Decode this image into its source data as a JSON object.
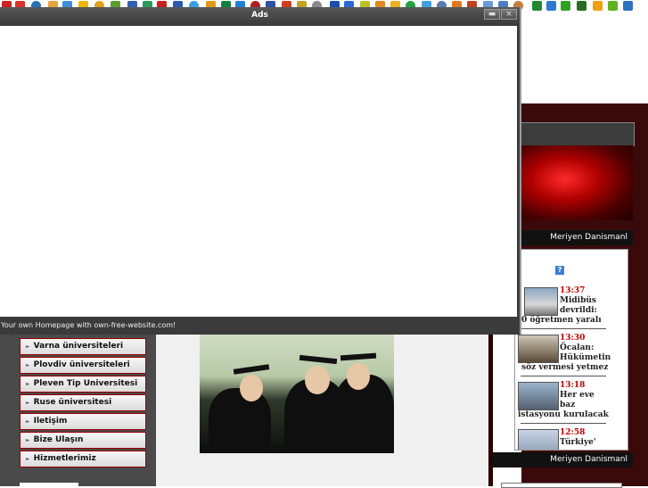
{
  "dialog": {
    "title": "Ads",
    "footer": "Your own Homepage with own-free-website.com!"
  },
  "bars": {
    "top": "Meriyen Danismanl",
    "bottom": "Meriyen Danismanl"
  },
  "menu": [
    "Varna üniversiteleri",
    "Plovdiv üniversiteleri",
    "Pleven Tip Universitesi",
    "Ruse üniversitesi",
    "Iletişim",
    "Bize Ulaşın",
    "Hizmetlerimiz"
  ],
  "news": [
    {
      "time": "13:37",
      "title_a": "Midibüs",
      "title_b": "devrildi:",
      "title_c": "0 öğretmen yaralı"
    },
    {
      "time": "13:30",
      "title_a": "Öcalan:",
      "title_b": "Hükümetin",
      "title_c": "söz vermesi yetmez"
    },
    {
      "time": "13:18",
      "title_a": "Her eve",
      "title_b": "baz",
      "title_c": "istasyonu kurulacak"
    },
    {
      "time": "12:58",
      "title_a": "Türkiye'",
      "title_b": "",
      "title_c": ""
    }
  ],
  "icons": {
    "info": "info-icon",
    "minimize": "minimize-icon",
    "close": "close-icon",
    "close_glyph": "×",
    "minimize_glyph": "▬",
    "info_glyph": "?"
  },
  "colors": {
    "accent_red": "#c00000",
    "dark_bg": "#3a0a0a",
    "dialog_bg": "#3b3b3b"
  }
}
